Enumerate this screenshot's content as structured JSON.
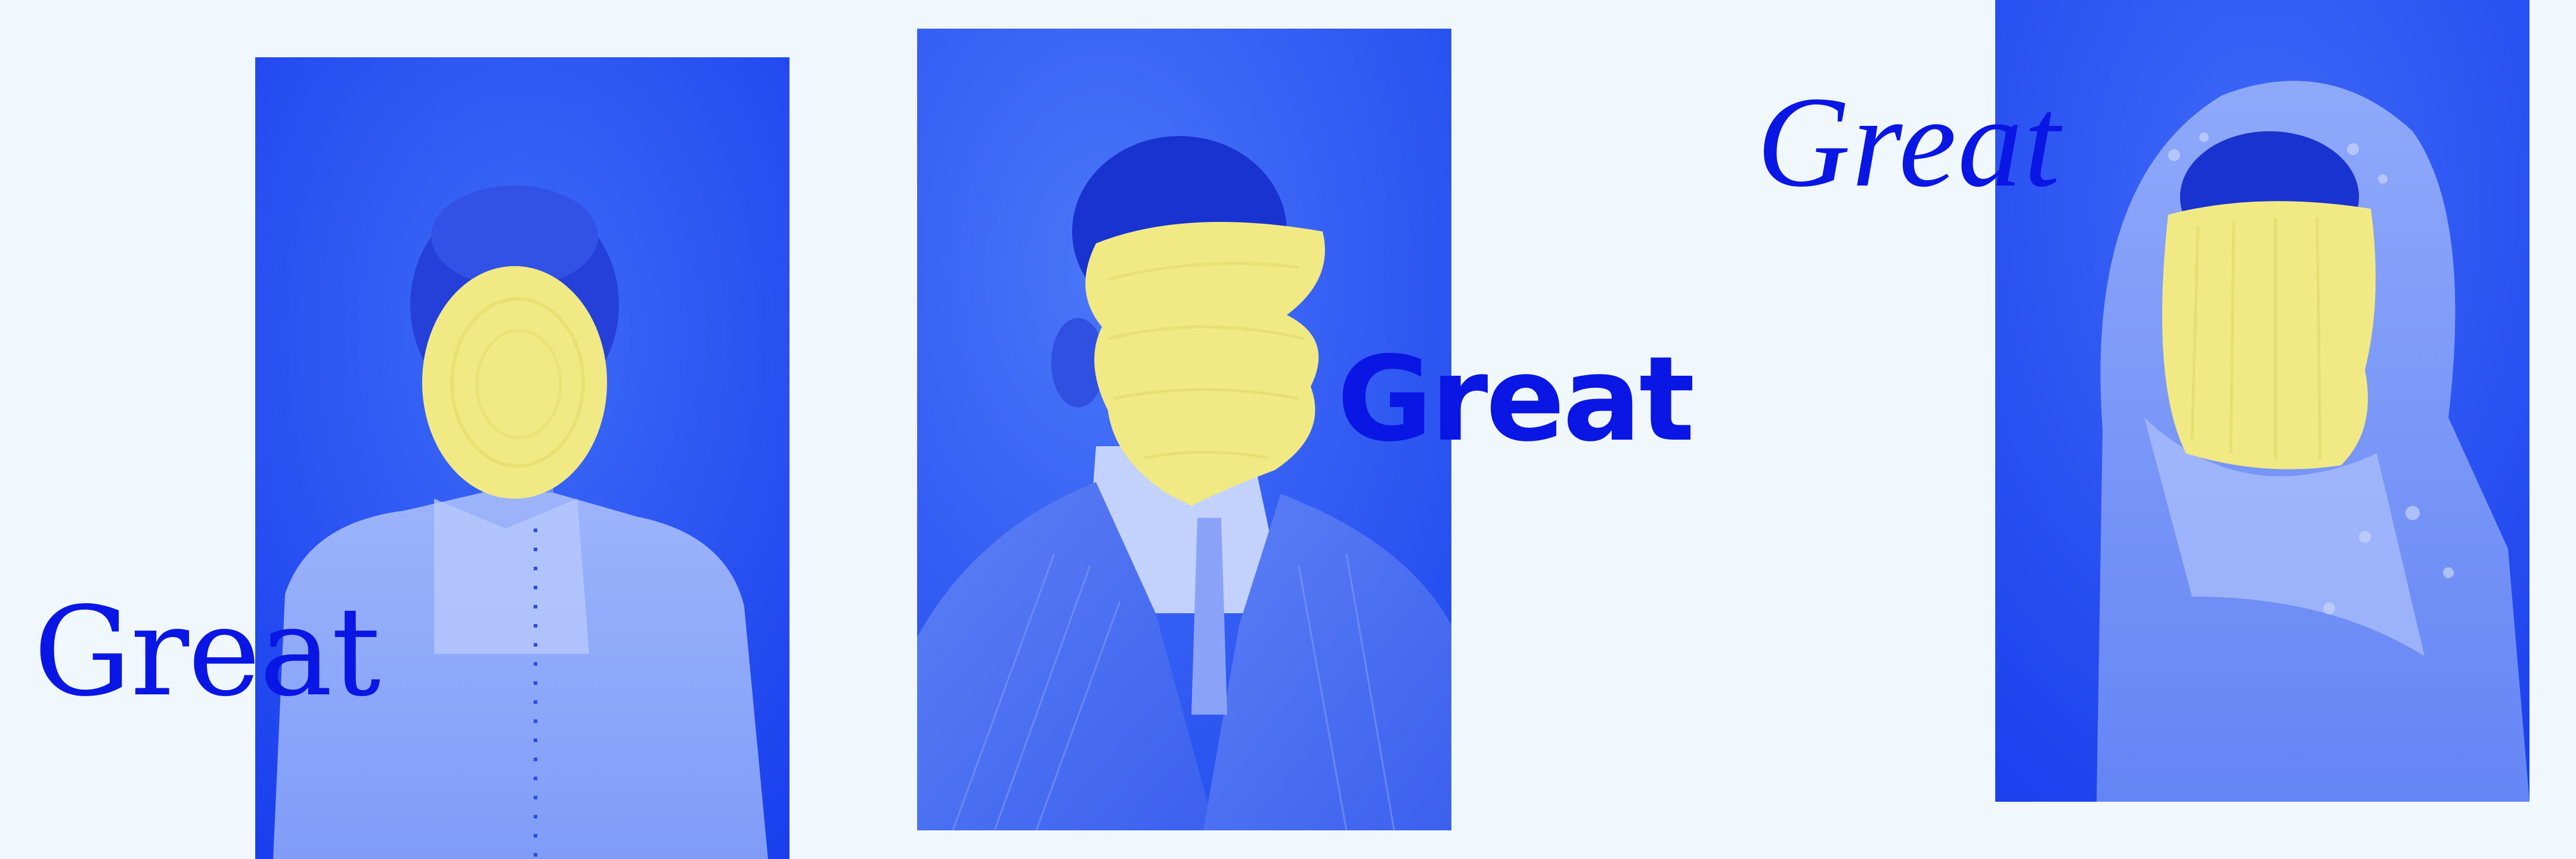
{
  "words": [
    "Great",
    "Great",
    "Great"
  ],
  "portraits": [
    {
      "subject": "woman in lace blouse",
      "face": "obscured by yellow paint"
    },
    {
      "subject": "man in pinstripe suit",
      "face": "obscured by yellow paint"
    },
    {
      "subject": "woman in patterned headscarf",
      "face": "obscured by yellow paint"
    }
  ],
  "colors": {
    "background": "#f1f8fd",
    "tint": "#1a3ff0",
    "paint": "#f1ea84",
    "text": "#0a16e4"
  }
}
